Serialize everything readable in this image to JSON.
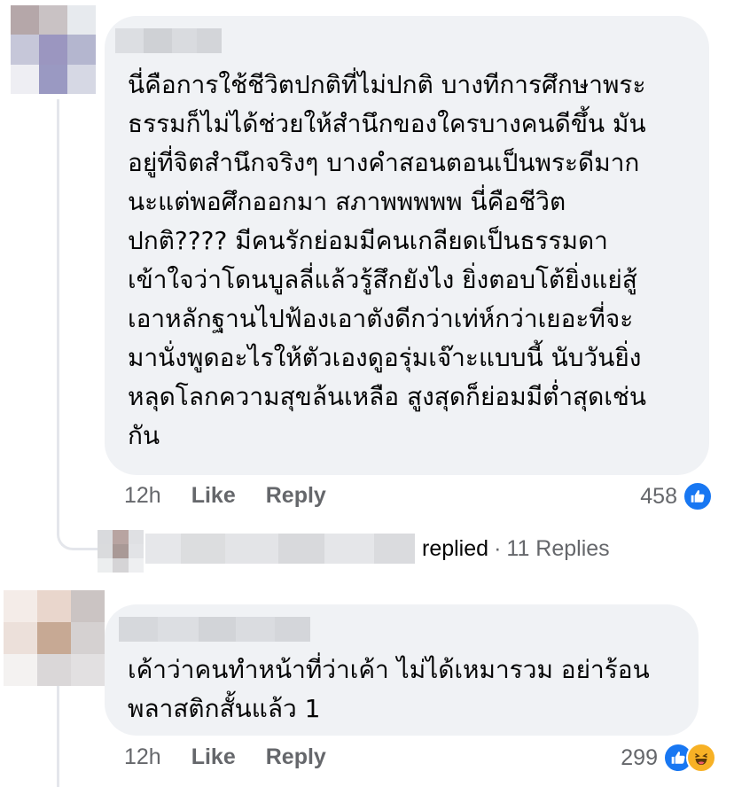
{
  "comments": [
    {
      "text": "นี่คือการใช้ชีวิตปกติที่ไม่ปกติ บางทีการศึกษาพระ\nธรรมก็ไม่ได้ช่วยให้สำนึกของใครบางคนดีขึ้น มัน\nอยู่ที่จิตสำนึกจริงๆ บางคำสอนตอนเป็นพระดีมาก\nนะแต่พอศึกออกมา สภาพพพพพ นี่คือชีวิต\nปกติ???? มีคนรักย่อมมีคนเกลียดเป็นธรรมดา\nเข้าใจว่าโดนบูลลี่แล้วรู้สึกยังไง ยิ่งตอบโต้ยิ่งแย่สู้\nเอาหลักฐานไปฟ้องเอาตังดีกว่าเท่ห์กว่าเยอะที่จะ\nมานั่งพูดอะไรให้ตัวเองดูอรุ่มเจ๊าะแบบนี้ นับวันยิ่ง\nหลุดโลกความสุขล้นเหลือ สูงสุดก็ย่อมมีต่ำสุดเช่น\nกัน",
      "time": "12h",
      "like_label": "Like",
      "reply_label": "Reply",
      "reaction_count": "458",
      "reactions": [
        "like-icon"
      ]
    },
    {
      "text": "เค้าว่าคนทำหน้าที่ว่าเค้า ไม่ได้เหมารวม อย่าร้อน\nพลาสติกสั้นแล้ว 1",
      "time": "12h",
      "like_label": "Like",
      "reply_label": "Reply",
      "reaction_count": "299",
      "reactions": [
        "like-icon",
        "haha-icon"
      ]
    }
  ],
  "replies_row": {
    "replied_label": "replied",
    "separator": "·",
    "replies_count": "11 Replies"
  },
  "colors": {
    "bubble_bg": "#f0f2f5",
    "meta_text": "#65676b",
    "like_blue": "#1877f2",
    "haha_yellow": "#f7b125"
  }
}
